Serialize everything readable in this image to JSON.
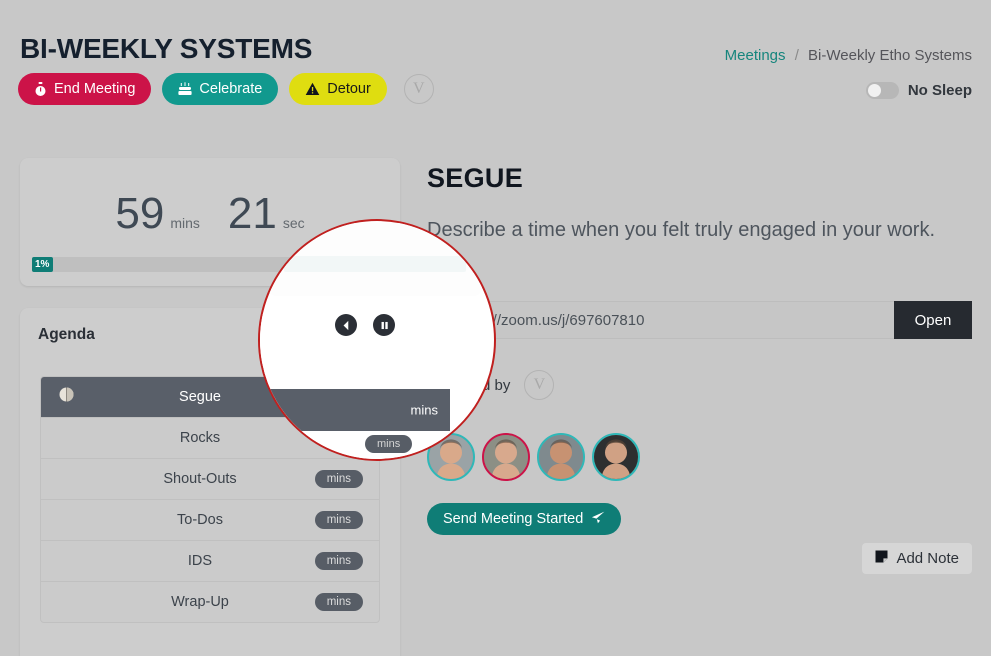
{
  "header": {
    "title": "BI-WEEKLY SYSTEMS",
    "actions": [
      {
        "id": "end-meeting",
        "label": "End Meeting",
        "icon": "stopwatch-icon",
        "color": "#cc1348"
      },
      {
        "id": "celebrate",
        "label": "Celebrate",
        "icon": "cake-icon",
        "color": "#11998e"
      },
      {
        "id": "detour",
        "label": "Detour",
        "icon": "warning-triangle-icon",
        "color": "#dfdd10"
      }
    ],
    "user_initial": "V",
    "breadcrumb": {
      "parent": "Meetings",
      "separator": "/",
      "current": "Bi-Weekly Etho Systems"
    },
    "sleep_toggle": {
      "label": "No Sleep",
      "state": "off"
    }
  },
  "timer": {
    "minutes": "59",
    "minutes_unit": "mins",
    "seconds": "21",
    "seconds_unit": "sec",
    "progress_label": "1%",
    "progress_percent": 1
  },
  "agenda": {
    "heading": "Agenda",
    "controls": [
      {
        "id": "back",
        "icon": "back-circle-icon"
      },
      {
        "id": "pause",
        "icon": "pause-circle-icon"
      }
    ],
    "items": [
      {
        "label": "Segue",
        "badge": "mins",
        "active": true,
        "icon": "half-circle-icon"
      },
      {
        "label": "Rocks",
        "badge": "mins",
        "active": false
      },
      {
        "label": "Shout-Outs",
        "badge": "mins",
        "active": false
      },
      {
        "label": "To-Dos",
        "badge": "mins",
        "active": false
      },
      {
        "label": "IDS",
        "badge": "mins",
        "active": false
      },
      {
        "label": "Wrap-Up",
        "badge": "mins",
        "active": false
      }
    ]
  },
  "segue": {
    "title": "SEGUE",
    "description": "Describe a time when you felt truly engaged in your work.",
    "link_value": "https://zoom.us/j/697607810",
    "link_placeholder": "https://",
    "open_label": "Open",
    "created_label": "Created by",
    "created_initial": "V",
    "participants": [
      {
        "name": "participant-1",
        "ring": "#2fb8b8"
      },
      {
        "name": "participant-2",
        "ring": "#cc1348"
      },
      {
        "name": "participant-3",
        "ring": "#2fb8b8"
      },
      {
        "name": "participant-4",
        "ring": "#2fb8b8"
      }
    ],
    "send_label": "Send Meeting Started",
    "send_icon": "paper-plane-icon",
    "add_note_label": "Add Note",
    "add_note_icon": "note-icon"
  },
  "magnifier": {
    "active_row_badge": "mins",
    "next_row_badge": "mins",
    "border_color": "#c0201f"
  }
}
